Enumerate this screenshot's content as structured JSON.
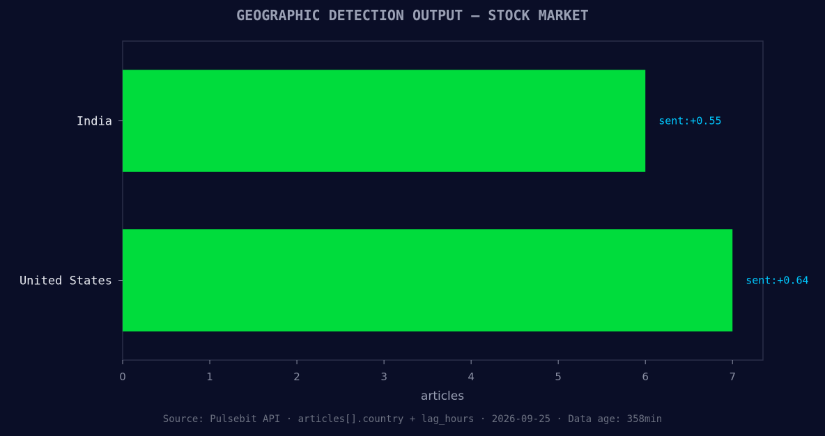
{
  "chart_data": {
    "type": "bar",
    "orientation": "horizontal",
    "title": "GEOGRAPHIC DETECTION OUTPUT — STOCK MARKET",
    "xlabel": "articles",
    "ylabel": "",
    "categories": [
      "India",
      "United States"
    ],
    "values": [
      6,
      7
    ],
    "annotations": [
      "sent:+0.55",
      "sent:+0.64"
    ],
    "xticks": [
      "0",
      "1",
      "2",
      "3",
      "4",
      "5",
      "6",
      "7"
    ],
    "xlim": [
      0,
      7.35
    ],
    "grid": false,
    "legend": "none",
    "colors": {
      "bar": "#00dc3c",
      "annotation": "#00c8ff",
      "background": "#0a0e27",
      "frame": "#2a2e48",
      "tick_text": "#8a8fa3",
      "category_text": "#e6e8ef"
    }
  },
  "footer": "Source: Pulsebit API · articles[].country + lag_hours · 2026-09-25 · Data age: 358min"
}
